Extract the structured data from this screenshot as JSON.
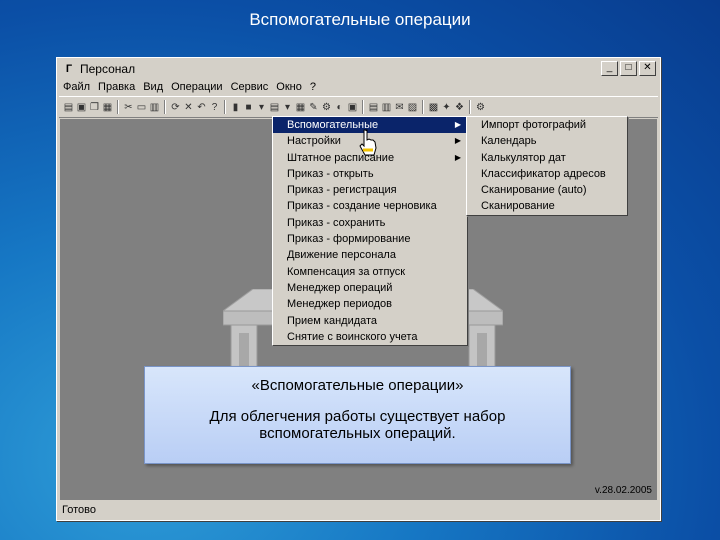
{
  "slide": {
    "title": "Вспомогательные операции"
  },
  "window": {
    "title": "Персонал",
    "controls": [
      "minimize",
      "maximize",
      "close"
    ],
    "status": "Готово",
    "version": "v.28.02.2005"
  },
  "menubar": [
    "Файл",
    "Правка",
    "Вид",
    "Операции",
    "Сервис",
    "Окно",
    "?"
  ],
  "toolbar_icons": [
    "print-icon",
    "save-icon",
    "copy-icon",
    "paste-icon",
    "cut-icon",
    "delete-icon",
    "undo-icon",
    "help-icon",
    "tool-icon",
    "tool-icon",
    "tool-icon",
    "tool-icon",
    "tool-icon",
    "tool-icon",
    "tool-icon",
    "tool-icon",
    "tool-icon",
    "tool-icon",
    "tool-icon",
    "tool-icon",
    "tool-icon",
    "tool-icon",
    "tool-icon"
  ],
  "main_menu": [
    {
      "label": "Вспомогательные",
      "submenu": true,
      "selected": true
    },
    {
      "label": "Настройки",
      "submenu": true
    },
    {
      "label": "Штатное расписание",
      "submenu": true
    },
    {
      "label": "Приказ - открыть"
    },
    {
      "label": "Приказ - регистрация"
    },
    {
      "label": "Приказ - создание черновика"
    },
    {
      "label": "Приказ - сохранить"
    },
    {
      "label": "Приказ - формирование"
    },
    {
      "label": "Движение персонала"
    },
    {
      "label": "Компенсация за отпуск"
    },
    {
      "label": "Менеджер операций"
    },
    {
      "label": "Менеджер периодов"
    },
    {
      "label": "Прием кандидата"
    },
    {
      "label": "Снятие с воинского учета"
    }
  ],
  "submenu": [
    {
      "label": "Импорт фотографий"
    },
    {
      "label": "Календарь"
    },
    {
      "label": "Калькулятор дат"
    },
    {
      "label": "Классификатор адресов"
    },
    {
      "label": "Сканирование (auto)"
    },
    {
      "label": "Сканирование"
    }
  ],
  "info_box": {
    "title": "«Вспомогательные операции»",
    "body": "Для облегчения работы существует набор вспомогательных операций."
  }
}
